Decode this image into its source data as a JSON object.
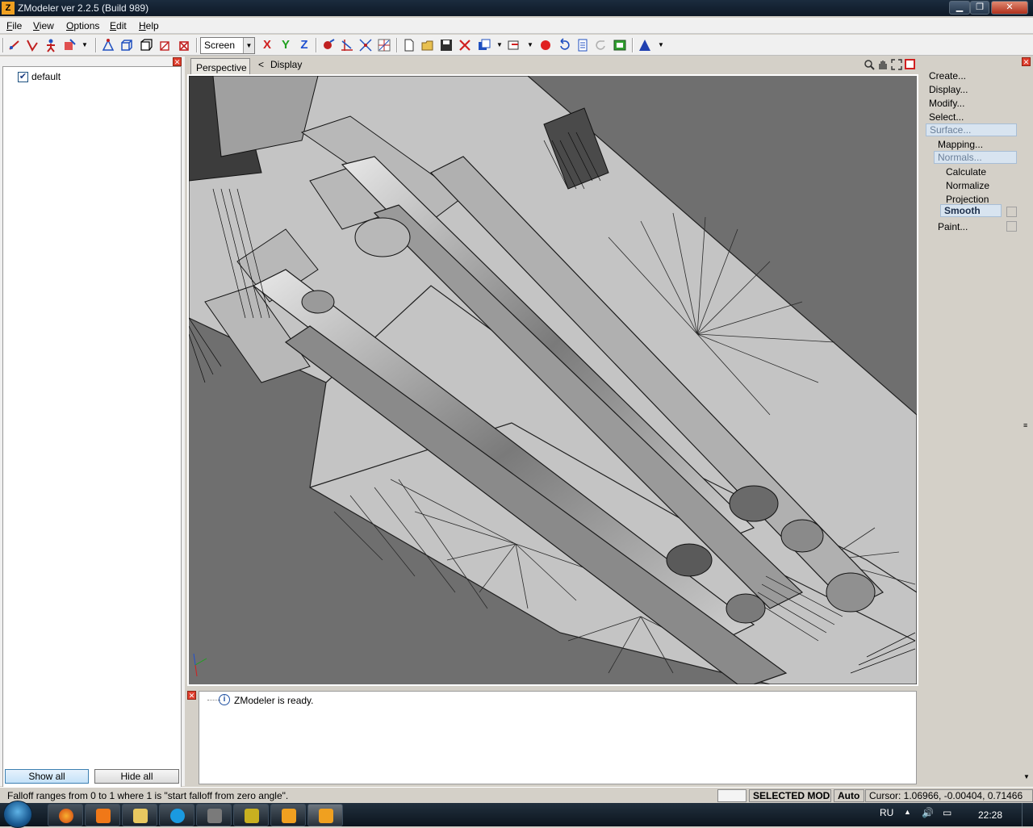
{
  "window": {
    "title": "ZModeler ver 2.2.5 (Build 989)",
    "app_icon": "Z"
  },
  "menu": [
    "File",
    "View",
    "Options",
    "Edit",
    "Help"
  ],
  "toolbar": {
    "space_select": "Screen",
    "axis_x": "X",
    "axis_y": "Y",
    "axis_z": "Z"
  },
  "left_panel": {
    "tree": [
      {
        "label": "default",
        "checked": true
      }
    ],
    "show_all": "Show all",
    "hide_all": "Hide all"
  },
  "viewport": {
    "tab": "Perspective",
    "display_label": "Display",
    "collapse_glyph": "<"
  },
  "log": {
    "message": "ZModeler is ready."
  },
  "right_panel": {
    "items": [
      {
        "label": "Create...",
        "level": 0
      },
      {
        "label": "Display...",
        "level": 0
      },
      {
        "label": "Modify...",
        "level": 0
      },
      {
        "label": "Select...",
        "level": 0
      },
      {
        "label": "Surface...",
        "level": 0,
        "selected": true
      },
      {
        "label": "Mapping...",
        "level": 1
      },
      {
        "label": "Normals...",
        "level": 1,
        "selected": true
      },
      {
        "label": "Calculate",
        "level": 2
      },
      {
        "label": "Normalize",
        "level": 2
      },
      {
        "label": "Projection",
        "level": 2
      },
      {
        "label": "Smooth",
        "level": 2,
        "active": true
      },
      {
        "label": "Paint...",
        "level": 1
      }
    ]
  },
  "status": {
    "hint": "Falloff ranges from 0 to 1 where 1 is \"start falloff from zero angle\".",
    "mode": "SELECTED MODE",
    "auto": "Auto",
    "cursor": "Cursor: 1.06966, -0.00404, 0.71466"
  },
  "taskbar": {
    "lang": "RU",
    "clock": "22:28"
  },
  "colors": {
    "viewport_bg": "#6f6f6f",
    "mesh_fill": "#c4c4c4",
    "title_bar": "#14202e",
    "selection": "#d8e4f0"
  }
}
